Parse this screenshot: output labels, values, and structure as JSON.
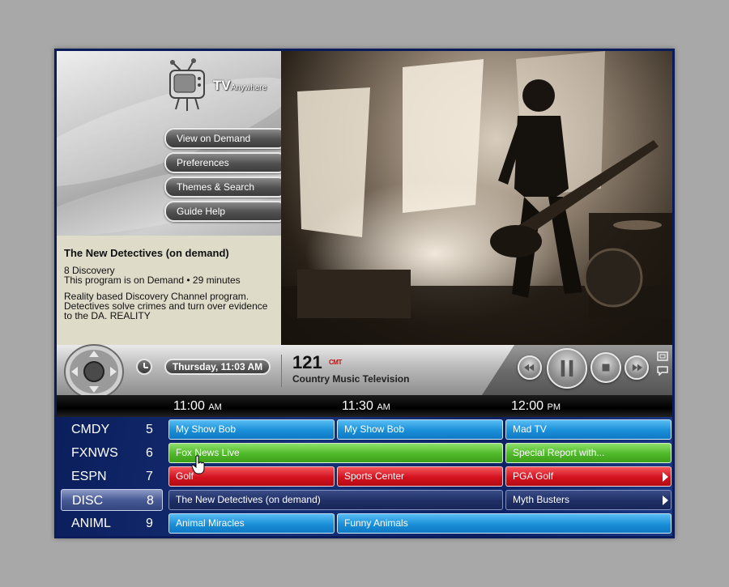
{
  "brand": {
    "logo_main": "TV",
    "logo_sub": "Anywhere"
  },
  "menu": {
    "items": [
      {
        "label": "View on Demand"
      },
      {
        "label": "Preferences"
      },
      {
        "label": "Themes & Search"
      },
      {
        "label": "Guide Help"
      }
    ]
  },
  "info": {
    "title": "The New Detectives (on demand)",
    "channel_line": "8 Discovery",
    "status_line": "This program is on Demand • 29 minutes",
    "description": "Reality based Discovery Channel program. Detectives solve crimes and turn over evidence to the DA. REALITY"
  },
  "video": {
    "description_icon": "concert-video-frame"
  },
  "controls": {
    "datetime": "Thursday, 11:03 AM",
    "channel_number": "121",
    "channel_logo": "CMT",
    "channel_name": "Country Music Television",
    "icons": [
      "dpad-icon",
      "clock-icon",
      "rewind-icon",
      "pause-icon",
      "stop-icon",
      "fast-forward-icon",
      "fullscreen-icon",
      "chat-icon"
    ]
  },
  "guide": {
    "times": [
      {
        "time": "11:00",
        "ampm": "AM"
      },
      {
        "time": "11:30",
        "ampm": "AM"
      },
      {
        "time": "12:00",
        "ampm": "PM"
      }
    ],
    "rows": [
      {
        "call": "CMDY",
        "number": "5",
        "programs": [
          "My Show Bob",
          "My Show Bob",
          "Mad TV"
        ]
      },
      {
        "call": "FXNWS",
        "number": "6",
        "programs": [
          "Fox News Live",
          "Special Report with..."
        ]
      },
      {
        "call": "ESPN",
        "number": "7",
        "programs": [
          "Golf",
          "Sports Center",
          "PGA Golf"
        ]
      },
      {
        "call": "DISC",
        "number": "8",
        "programs": [
          "The New Detectives (on demand)",
          "Myth Busters"
        ]
      },
      {
        "call": "ANIML",
        "number": "9",
        "programs": [
          "Animal Miracles",
          "Funny Animals"
        ]
      }
    ],
    "selected_channel": "DISC"
  }
}
